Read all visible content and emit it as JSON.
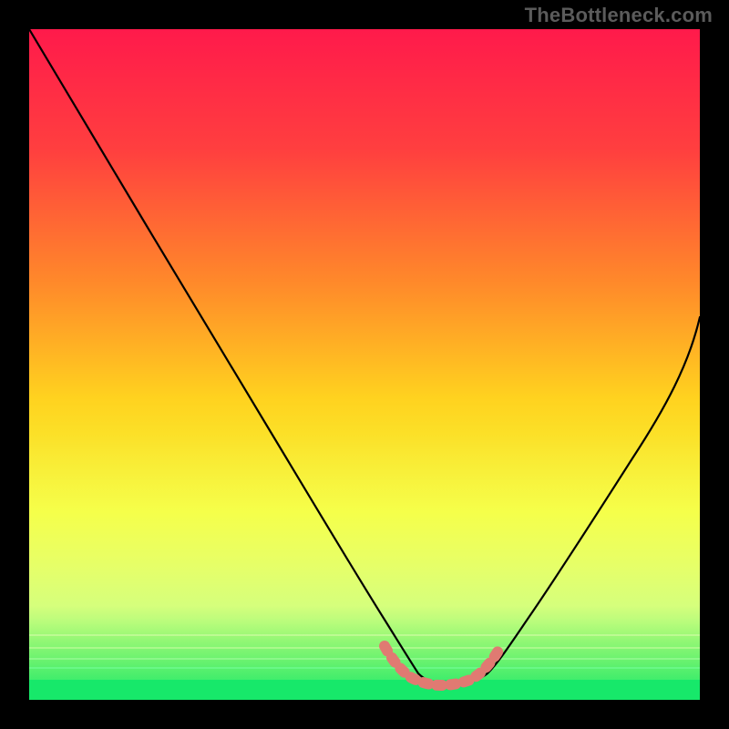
{
  "watermark": "TheBottleneck.com",
  "chart_data": {
    "type": "line",
    "title": "",
    "xlabel": "",
    "ylabel": "",
    "xlim": [
      0,
      100
    ],
    "ylim": [
      0,
      100
    ],
    "background_gradient": {
      "stops": [
        {
          "offset": 0,
          "color": "#ff1a4b"
        },
        {
          "offset": 18,
          "color": "#ff3f3f"
        },
        {
          "offset": 38,
          "color": "#ff8a2a"
        },
        {
          "offset": 55,
          "color": "#ffd21f"
        },
        {
          "offset": 72,
          "color": "#f4ff3a"
        },
        {
          "offset": 86,
          "color": "#d6ff6a"
        },
        {
          "offset": 100,
          "color": "#17e86a"
        }
      ]
    },
    "series": [
      {
        "name": "curve",
        "color": "#000000",
        "x": [
          0,
          6,
          12,
          18,
          24,
          30,
          36,
          42,
          48,
          53,
          56,
          58,
          60,
          62,
          65,
          68,
          70,
          73,
          78,
          84,
          90,
          96,
          100
        ],
        "y": [
          100,
          90,
          80,
          70,
          60,
          50,
          40,
          30,
          20,
          12,
          7,
          4,
          3,
          2.5,
          2.5,
          3,
          4,
          7,
          14,
          24,
          36,
          48,
          57
        ]
      },
      {
        "name": "highlight-band",
        "color": "#e07a72",
        "x": [
          53,
          56,
          58,
          60,
          62,
          65,
          68,
          70
        ],
        "y": [
          8,
          5,
          3,
          2.5,
          2.2,
          2.5,
          3,
          5
        ]
      }
    ],
    "green_band_y": [
      0,
      3
    ]
  }
}
